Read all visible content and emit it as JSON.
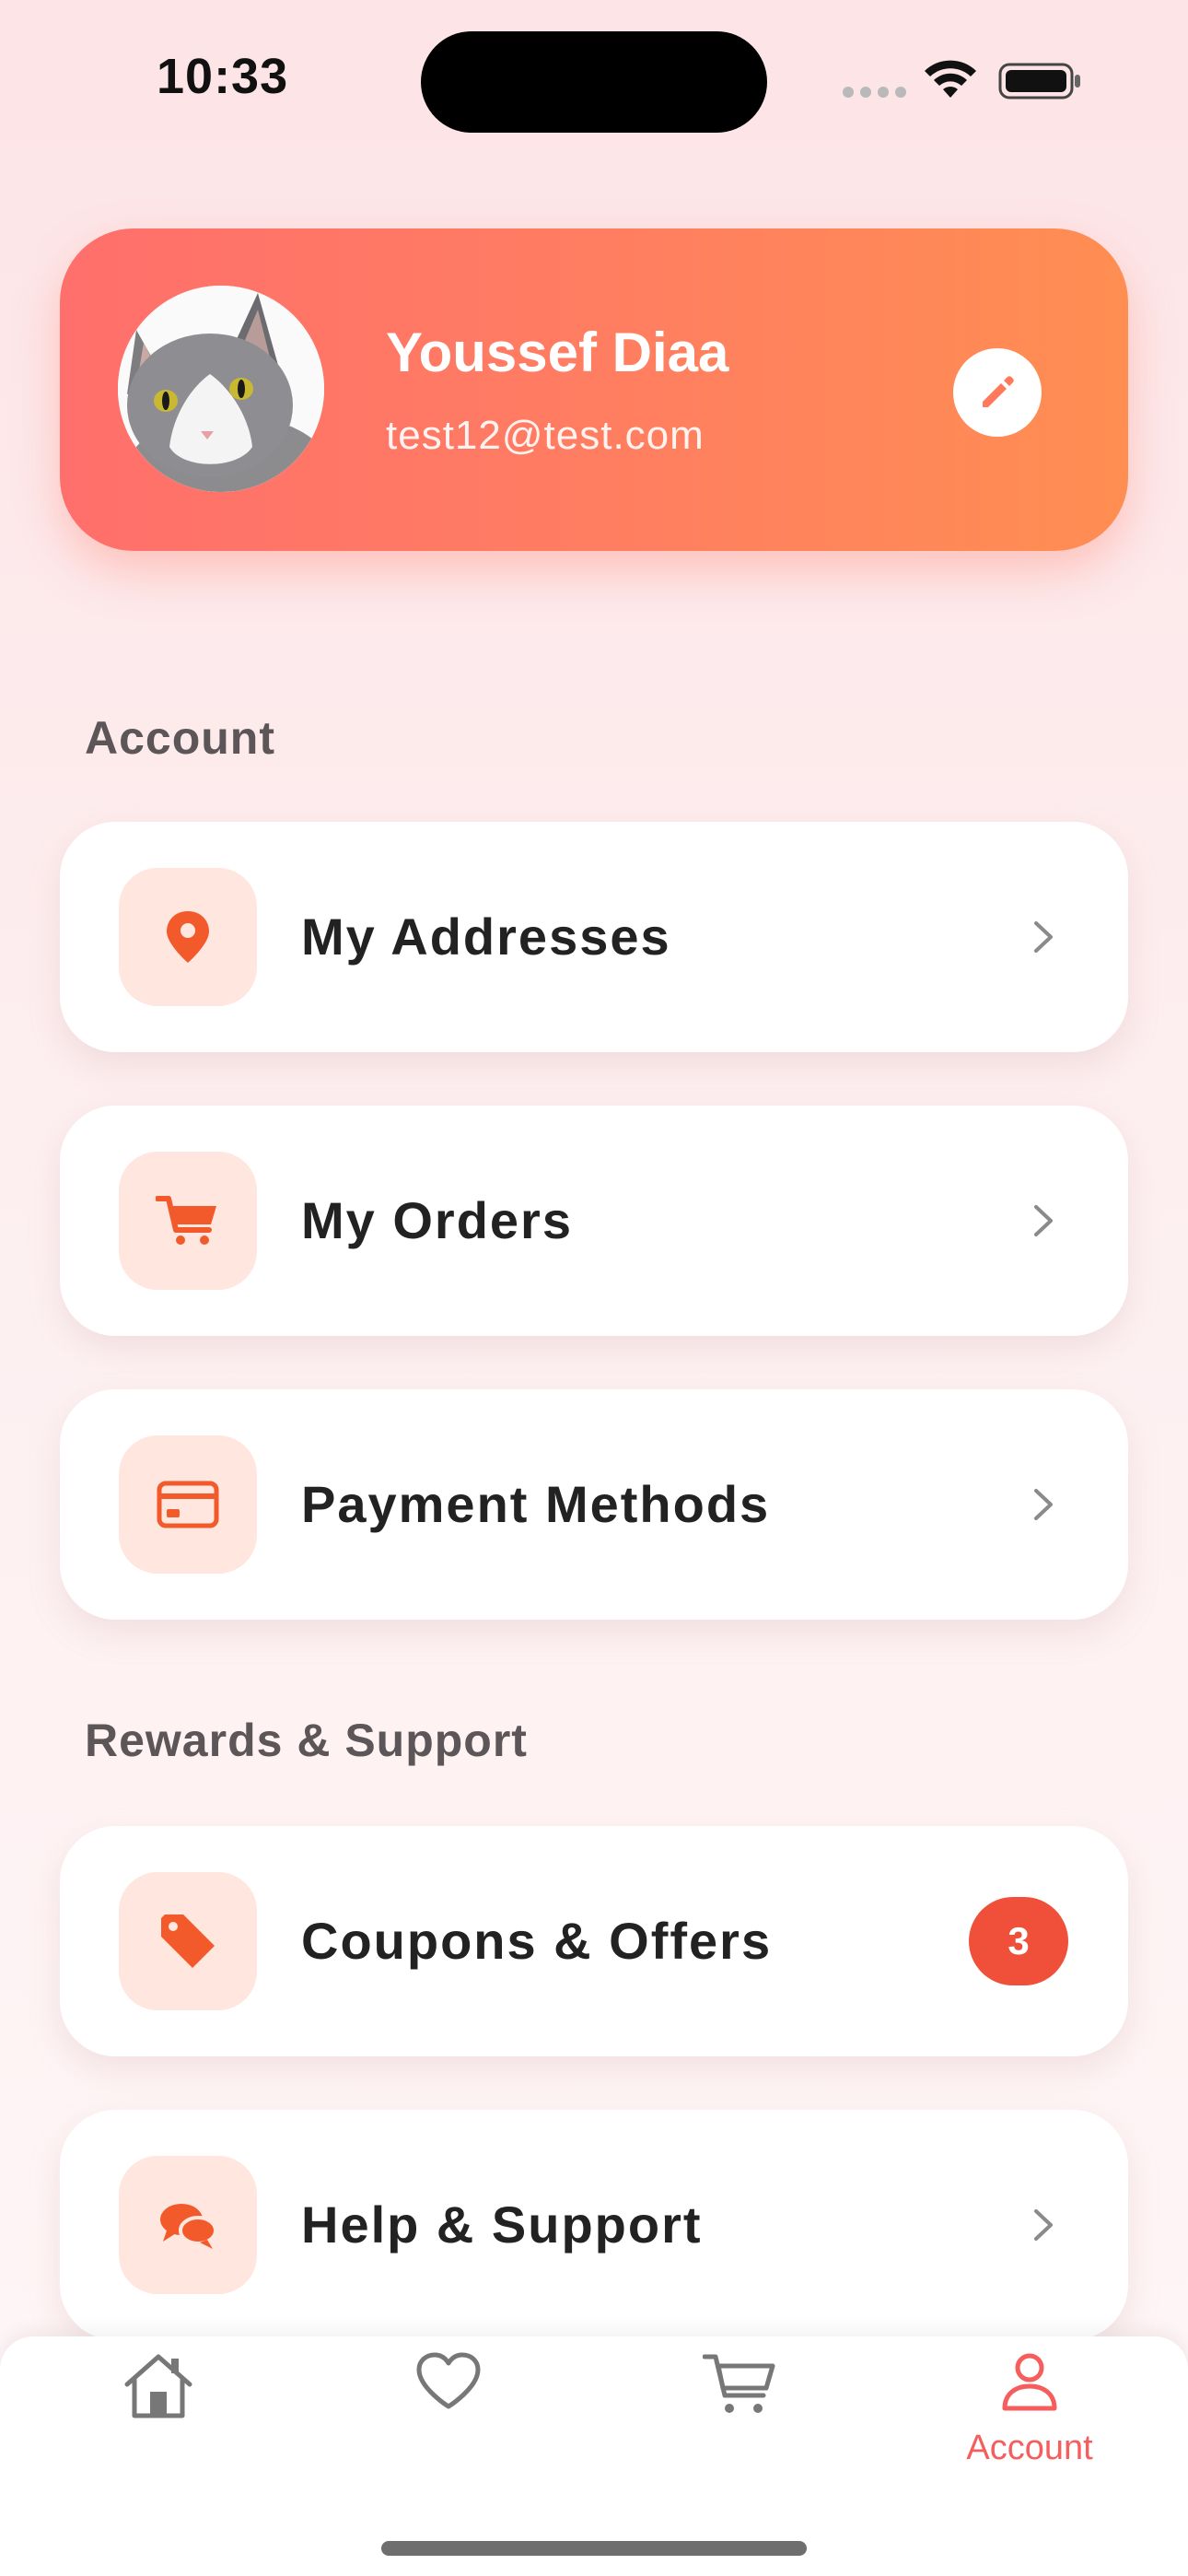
{
  "status_bar": {
    "time": "10:33"
  },
  "profile": {
    "name": "Youssef Diaa",
    "email": "test12@test.com"
  },
  "sections": {
    "account_title": "Account",
    "rewards_title": "Rewards & Support"
  },
  "menu": {
    "addresses": "My Addresses",
    "orders": "My Orders",
    "payment": "Payment Methods",
    "coupons": "Coupons & Offers",
    "coupons_badge": "3",
    "help": "Help & Support"
  },
  "tab_bar": {
    "account_label": "Account",
    "active_tab": "account"
  },
  "colors": {
    "accent": "#f65d5d",
    "icon_orange": "#f25a2c",
    "icon_bg": "#ffe6df",
    "badge": "#f0503a"
  },
  "icons": [
    "location-pin-icon",
    "cart-icon",
    "credit-card-icon",
    "tag-icon",
    "chat-bubbles-icon",
    "home-icon",
    "heart-icon",
    "cart-icon",
    "person-icon",
    "edit-pencil-icon",
    "chevron-right-icon"
  ]
}
